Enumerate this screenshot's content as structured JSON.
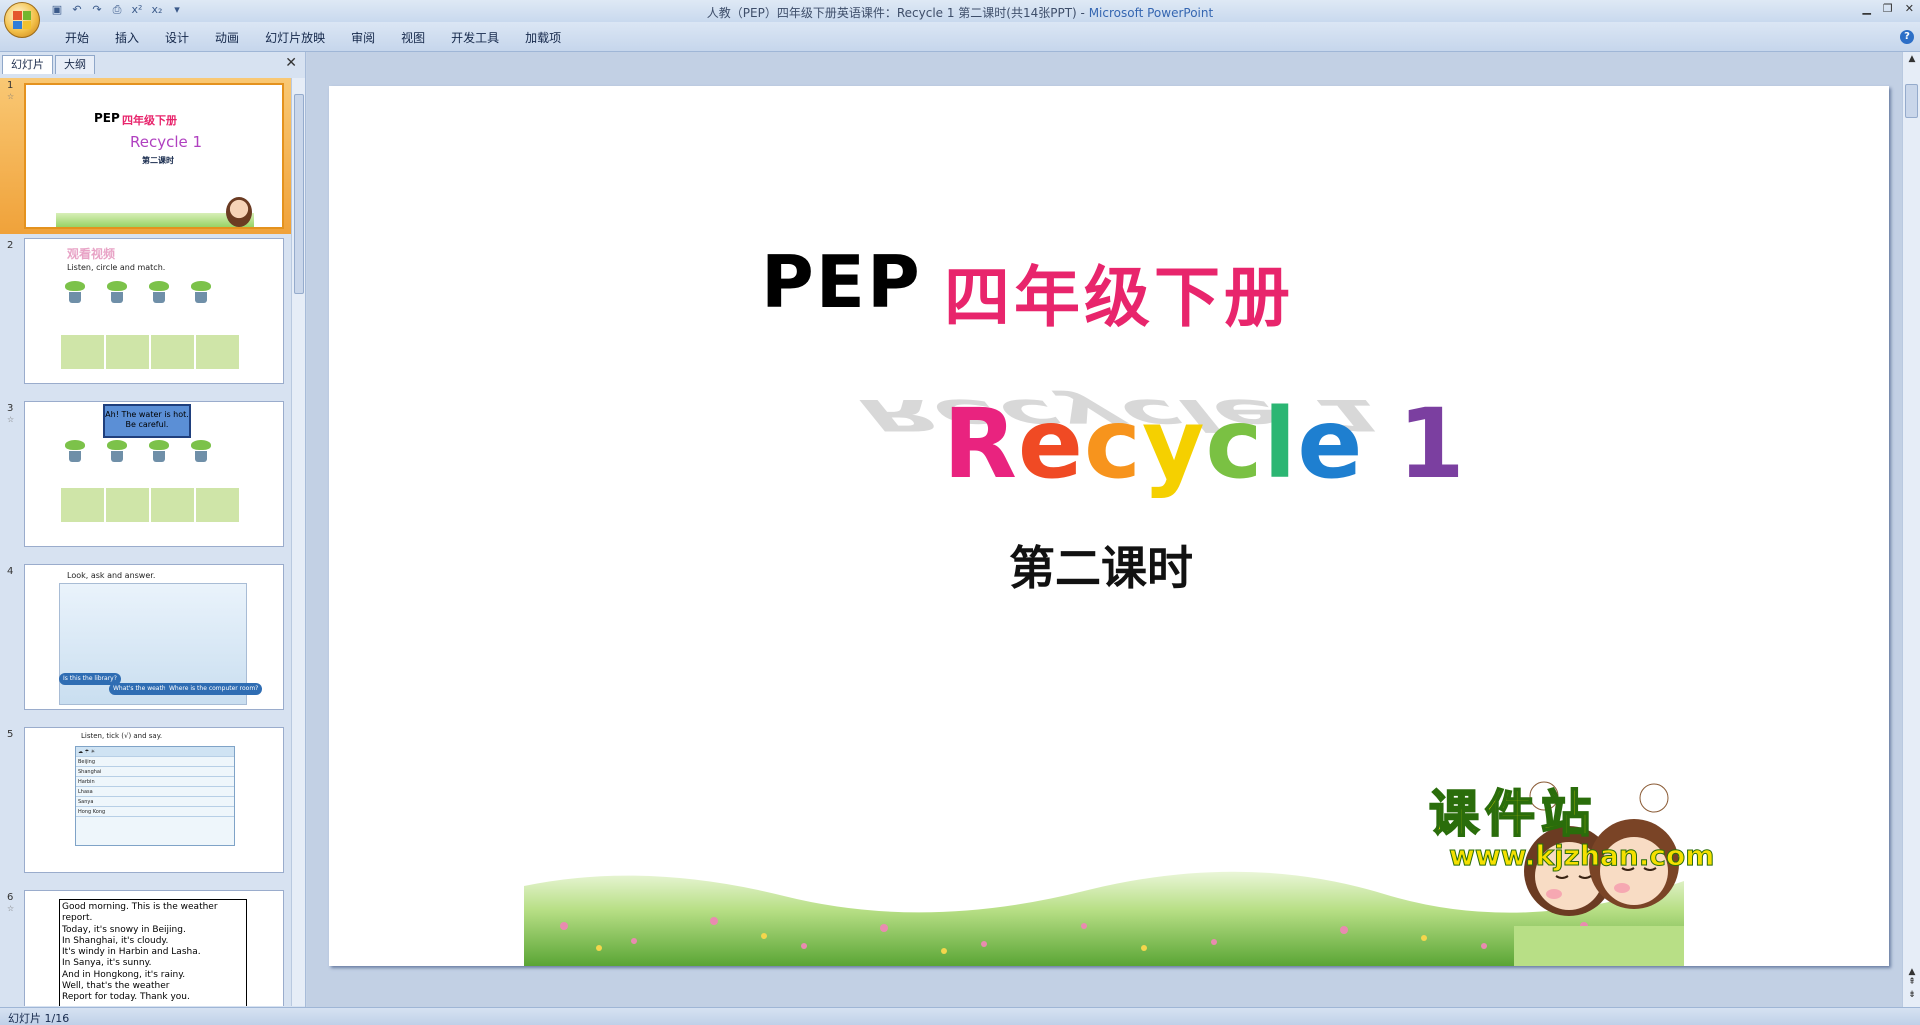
{
  "window": {
    "title": "人教（PEP）四年级下册英语课件：Recycle 1 第二课时(共14张PPT)",
    "separator": " - ",
    "app_name": "Microsoft PowerPoint"
  },
  "ribbon": {
    "tabs": [
      "开始",
      "插入",
      "设计",
      "动画",
      "幻灯片放映",
      "审阅",
      "视图",
      "开发工具",
      "加载项"
    ]
  },
  "panel": {
    "tabs": [
      "幻灯片",
      "大纲"
    ],
    "close_glyph": "✕"
  },
  "thumbnails": [
    {
      "num": "1",
      "pep": "PEP",
      "grade": "四年级下册",
      "recycle": "Recycle 1",
      "lesson": "第二课时"
    },
    {
      "num": "2",
      "heading": "观看视频",
      "instruction": "Listen, circle and match."
    },
    {
      "num": "3",
      "bubble_line1": "Ah! The water is hot.",
      "bubble_line2": "Be careful."
    },
    {
      "num": "4",
      "instruction": "Look, ask and answer.",
      "bubbles": [
        "Is this the library?",
        "What's the weather like?",
        "Where is the computer room?"
      ]
    },
    {
      "num": "5",
      "instruction": "Listen, tick (√) and say.",
      "cities": [
        "Beijing",
        "Shanghai",
        "Harbin",
        "Lhasa",
        "Sanya",
        "Hong Kong"
      ]
    },
    {
      "num": "6",
      "lines": [
        "Good morning. This is the weather report.",
        "Today, it's snowy in Beijing.",
        "In Shanghai, it's cloudy.",
        "It's windy in Harbin and Lasha.",
        "In Sanya, it's sunny.",
        "And in Hongkong, it's rainy.",
        "Well, that's the weather",
        "Report for today. Thank you."
      ]
    }
  ],
  "slide": {
    "pep": "PEP",
    "grade": "四年级下册",
    "recycle_letters": [
      "R",
      "e",
      "c",
      "y",
      "c",
      "l",
      "e",
      " ",
      "1"
    ],
    "recycle_colors": [
      "#e9237f",
      "#f04a24",
      "#f7941d",
      "#f5d000",
      "#7ac143",
      "#2bb673",
      "#1e7fd0",
      "#ffffff",
      "#7b3fa0"
    ],
    "lesson": "第二课时"
  },
  "watermark": {
    "cn": "课件站",
    "url": "www.kjzhan.com"
  },
  "status": {
    "text": "幻灯片 1/16"
  }
}
